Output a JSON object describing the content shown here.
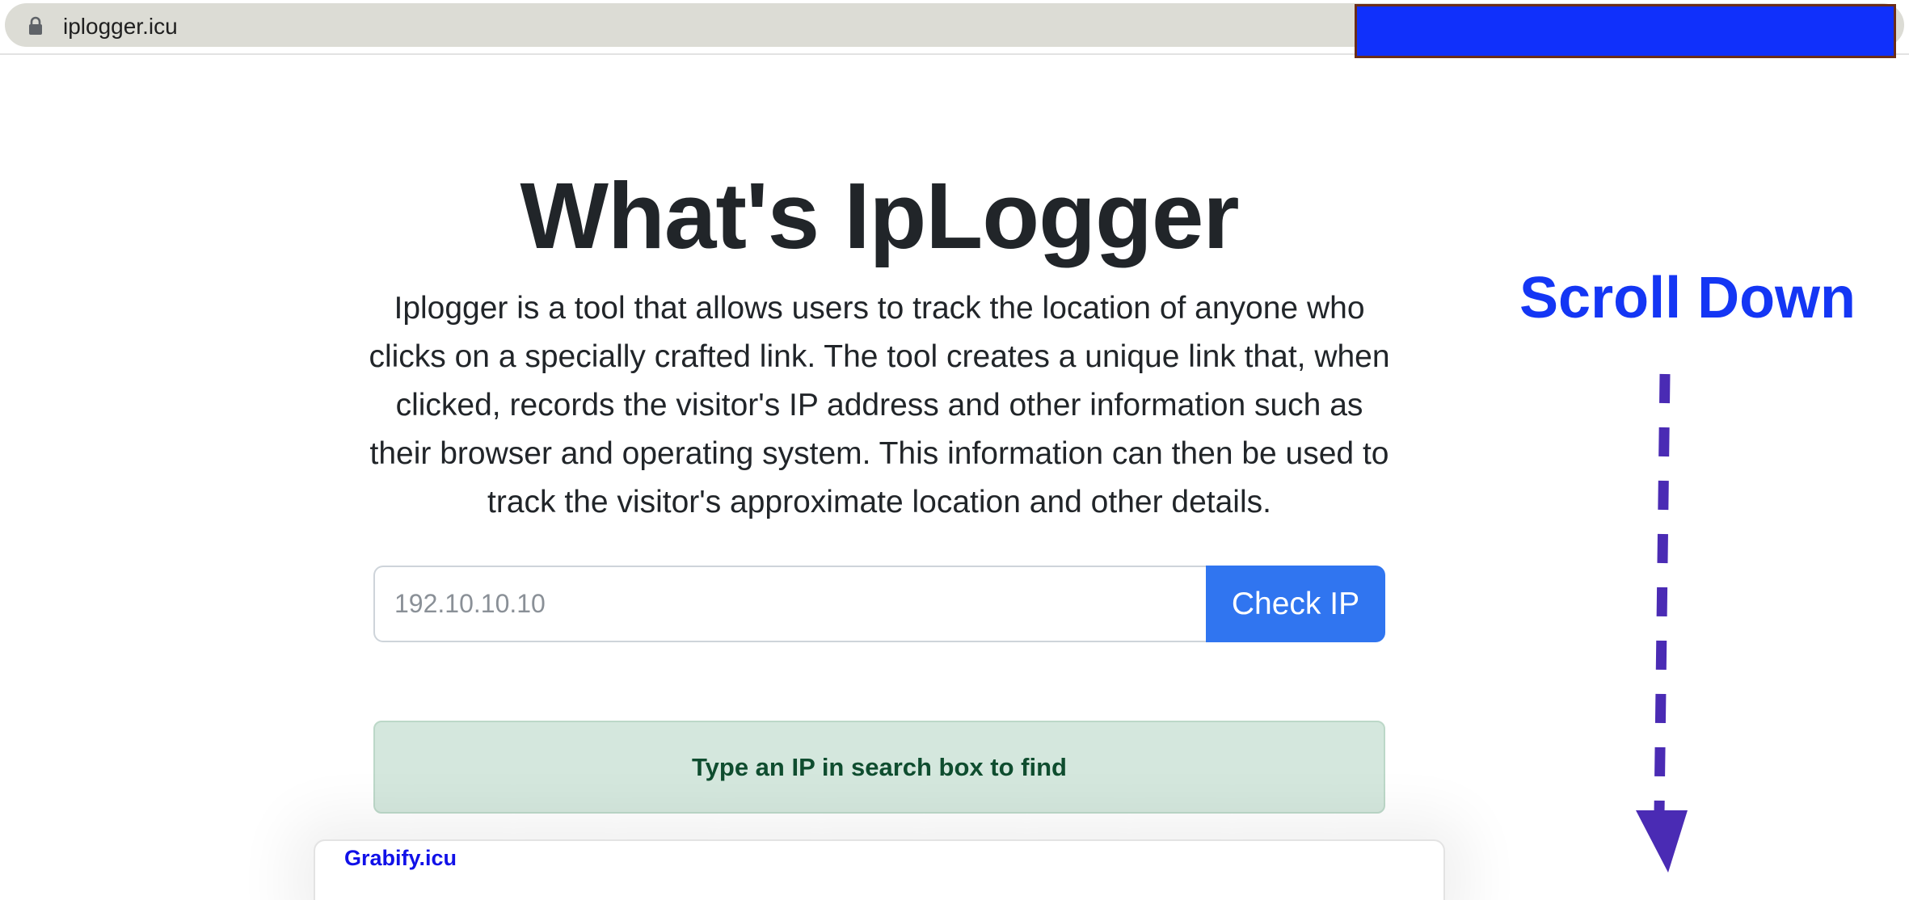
{
  "browser": {
    "url": "iplogger.icu",
    "lock_icon": "lock-icon",
    "redaction_color": "#1030fb"
  },
  "hero": {
    "title": "What's IpLogger",
    "description": "Iplogger is a tool that allows users to track the location of anyone who clicks on a specially crafted link. The tool creates a unique link that, when clicked, records the visitor's IP address and other information such as their browser and operating system. This information can then be used to track the visitor's approximate location and other details."
  },
  "search": {
    "placeholder": "192.10.10.10",
    "button_label": "Check IP"
  },
  "alert": {
    "text": "Type an IP in search box to find"
  },
  "card": {
    "link_text": "Grabify.icu"
  },
  "overlay": {
    "scroll_label": "Scroll Down",
    "arrow_icon": "dashed-down-arrow-icon",
    "arrow_color": "#4a2bb4"
  },
  "colors": {
    "button_bg": "#3075f0",
    "alert_bg": "#d4e7dd",
    "alert_text": "#0f4d2f",
    "scroll_label": "#1436f4"
  }
}
